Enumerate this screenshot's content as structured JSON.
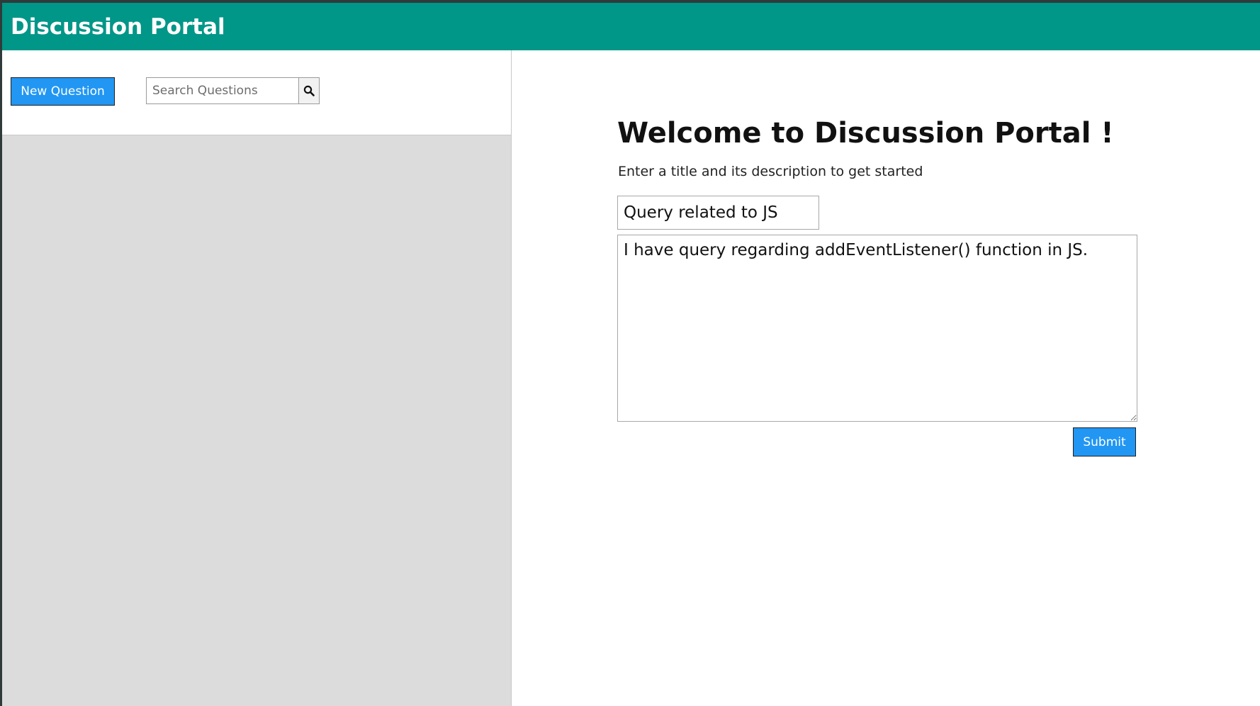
{
  "header": {
    "title": "Discussion Portal"
  },
  "sidebar": {
    "new_question_label": "New Question",
    "search": {
      "placeholder": "Search Questions",
      "value": "",
      "button_icon": "search-icon"
    }
  },
  "main": {
    "welcome_title": "Welcome to Discussion Portal !",
    "welcome_subtitle": "Enter a title and its description to get started",
    "title_field": {
      "value": "Query related to JS"
    },
    "description_field": {
      "value": "I have query regarding addEventListener() function in JS."
    },
    "submit_label": "Submit"
  },
  "colors": {
    "header_bg": "#009688",
    "button_bg": "#2196f3",
    "left_pane_bg": "#dcdcdc"
  }
}
